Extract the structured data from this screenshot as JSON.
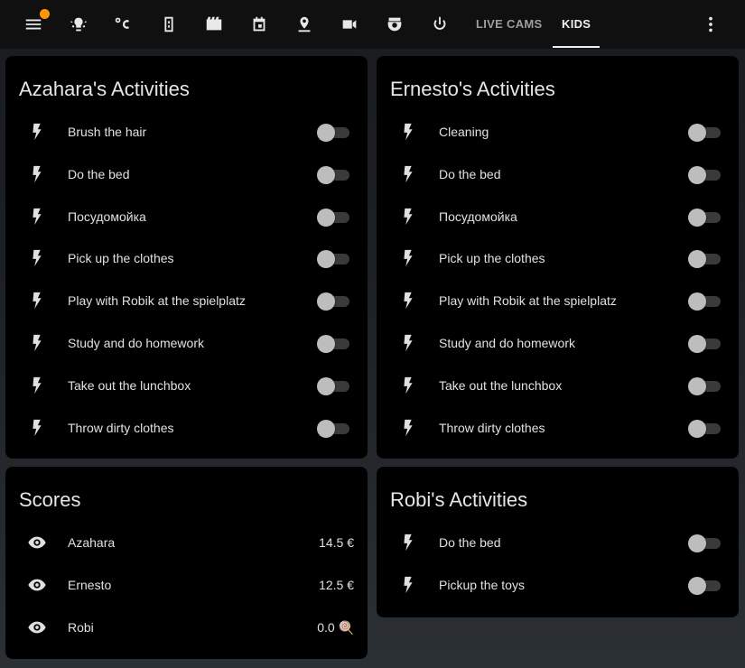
{
  "header": {
    "tabs": [
      {
        "icon": "menu-icon"
      },
      {
        "icon": "lightbulb-group-icon"
      },
      {
        "icon": "thermometer-celsius-icon"
      },
      {
        "icon": "door-sensor-icon"
      },
      {
        "icon": "movie-icon"
      },
      {
        "icon": "calendar-icon"
      },
      {
        "icon": "location-icon"
      },
      {
        "icon": "video-camera-icon"
      },
      {
        "icon": "robot-vacuum-icon"
      },
      {
        "icon": "power-icon"
      }
    ],
    "text_tabs": [
      "LIVE CAMS",
      "KIDS"
    ],
    "active_tab": "KIDS",
    "notification_color": "#ff9800"
  },
  "cards": {
    "azahara": {
      "title": "Azahara's Activities",
      "items": [
        "Brush the hair",
        "Do the bed",
        "Посудомойка",
        "Pick up the clothes",
        "Play with Robik at the spielplatz",
        "Study and do homework",
        "Take out the lunchbox",
        "Throw dirty clothes"
      ]
    },
    "ernesto": {
      "title": "Ernesto's Activities",
      "items": [
        "Cleaning",
        "Do the bed",
        "Посудомойка",
        "Pick up the clothes",
        "Play with Robik at the spielplatz",
        "Study and do homework",
        "Take out the lunchbox",
        "Throw dirty clothes"
      ]
    },
    "scores": {
      "title": "Scores",
      "rows": [
        {
          "name": "Azahara",
          "value": "14.5 €"
        },
        {
          "name": "Ernesto",
          "value": "12.5 €"
        },
        {
          "name": "Robi",
          "value": "0.0 🍭"
        }
      ]
    },
    "robi": {
      "title": "Robi's Activities",
      "items": [
        "Do the bed",
        "Pickup the toys"
      ]
    }
  },
  "toggle_state": "off"
}
